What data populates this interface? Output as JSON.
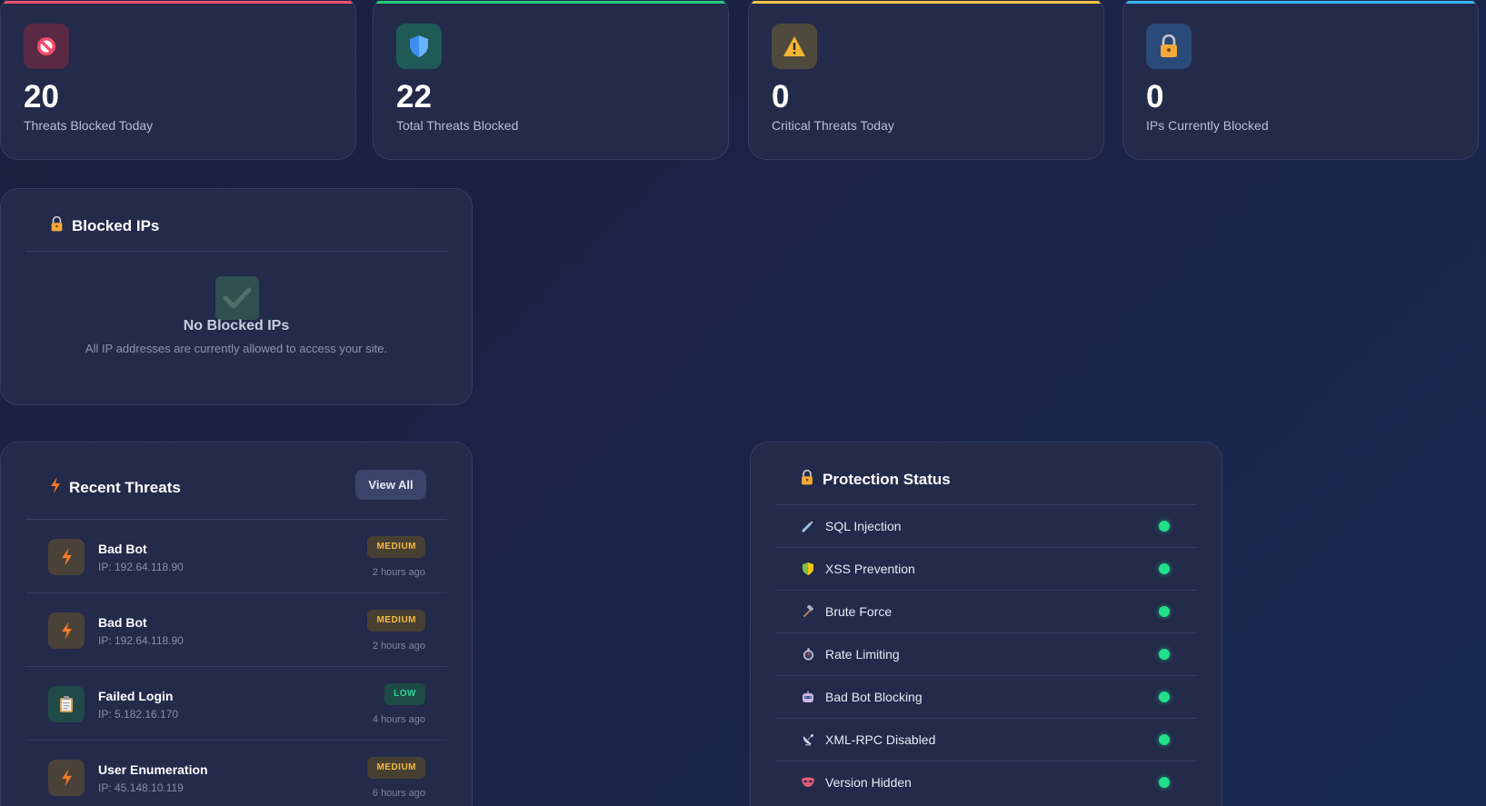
{
  "stats": [
    {
      "value": "20",
      "label": "Threats Blocked Today",
      "icon": "no-entry-icon",
      "accent": "#f0506e"
    },
    {
      "value": "22",
      "label": "Total Threats Blocked",
      "icon": "shield-icon",
      "accent": "#22d07a"
    },
    {
      "value": "0",
      "label": "Critical Threats Today",
      "icon": "warning-icon",
      "accent": "#f4c542"
    },
    {
      "value": "0",
      "label": "IPs Currently Blocked",
      "icon": "lock-icon",
      "accent": "#38b6f0"
    }
  ],
  "blocked_ips": {
    "title": "Blocked IPs",
    "empty_title": "No Blocked IPs",
    "empty_desc": "All IP addresses are currently allowed to access your site."
  },
  "recent_threats": {
    "title": "Recent Threats",
    "view_all": "View All",
    "items": [
      {
        "name": "Bad Bot",
        "ip": "IP: 192.64.118.90",
        "severity": "MEDIUM",
        "time": "2 hours ago",
        "icon": "lightning-icon"
      },
      {
        "name": "Bad Bot",
        "ip": "IP: 192.64.118.90",
        "severity": "MEDIUM",
        "time": "2 hours ago",
        "icon": "lightning-icon"
      },
      {
        "name": "Failed Login",
        "ip": "IP: 5.182.16.170",
        "severity": "LOW",
        "time": "4 hours ago",
        "icon": "clipboard-icon"
      },
      {
        "name": "User Enumeration",
        "ip": "IP: 45.148.10.119",
        "severity": "MEDIUM",
        "time": "6 hours ago",
        "icon": "lightning-icon"
      }
    ]
  },
  "protection_status": {
    "title": "Protection Status",
    "items": [
      {
        "label": "SQL Injection",
        "icon": "syringe-icon",
        "enabled": true
      },
      {
        "label": "XSS Prevention",
        "icon": "shield-icon",
        "enabled": true
      },
      {
        "label": "Brute Force",
        "icon": "hammer-icon",
        "enabled": true
      },
      {
        "label": "Rate Limiting",
        "icon": "stopwatch-icon",
        "enabled": true
      },
      {
        "label": "Bad Bot Blocking",
        "icon": "robot-icon",
        "enabled": true
      },
      {
        "label": "XML-RPC Disabled",
        "icon": "satellite-icon",
        "enabled": true
      },
      {
        "label": "Version Hidden",
        "icon": "mask-icon",
        "enabled": true
      }
    ]
  }
}
